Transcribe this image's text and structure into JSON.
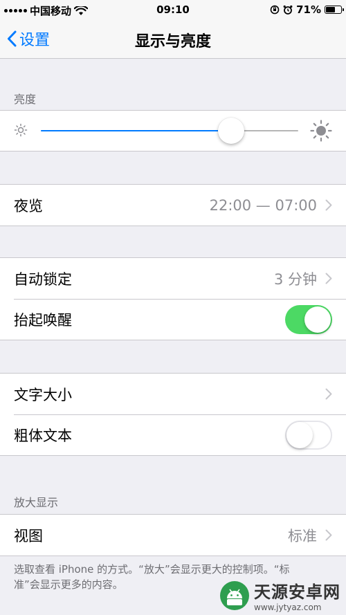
{
  "status_bar": {
    "carrier": "中国移动",
    "time": "09:10",
    "battery_pct": "71%",
    "battery_level": 0.71
  },
  "nav": {
    "back_label": "设置",
    "title": "显示与亮度"
  },
  "brightness": {
    "header": "亮度",
    "level": 0.74
  },
  "night_shift": {
    "label": "夜览",
    "value": "22:00 — 07:00"
  },
  "auto_lock": {
    "label": "自动锁定",
    "value": "3 分钟"
  },
  "raise_to_wake": {
    "label": "抬起唤醒",
    "on": true
  },
  "text_size": {
    "label": "文字大小"
  },
  "bold_text": {
    "label": "粗体文本",
    "on": false
  },
  "zoom": {
    "header": "放大显示",
    "view_label": "视图",
    "view_value": "标准",
    "footer": "选取查看 iPhone 的方式。“放大”会显示更大的控制项。“标准”会显示更多的内容。"
  },
  "watermark": {
    "title": "天源安卓网",
    "url": "www.jytyaz.com"
  },
  "colors": {
    "accent": "#007aff",
    "toggle_on": "#4cd964",
    "background": "#efeff4"
  }
}
